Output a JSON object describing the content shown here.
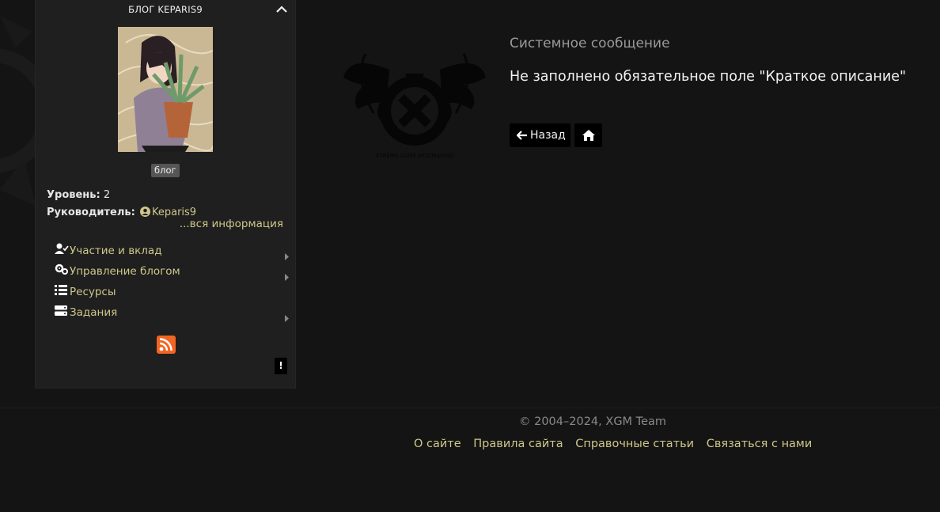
{
  "sidebar": {
    "title": "БЛОГ KEPARIS9",
    "badge": "блог",
    "level_label": "Уровень:",
    "level_value": "2",
    "leader_label": "Руководитель:",
    "leader_name": "Keparis9",
    "more_info": "...вся информация",
    "menu": [
      {
        "label": "Участие и вклад",
        "icon": "user-check-icon",
        "has_submenu": true
      },
      {
        "label": "Управление блогом",
        "icon": "gears-icon",
        "has_submenu": true
      },
      {
        "label": "Ресурсы",
        "icon": "list-icon",
        "has_submenu": false
      },
      {
        "label": "Задания",
        "icon": "server-icon",
        "has_submenu": true
      }
    ],
    "report_label": "!"
  },
  "message": {
    "title": "Системное сообщение",
    "text": "Не заполнено обязательное поле \"Краткое описание\"",
    "back_label": "Назад"
  },
  "footer": {
    "copyright": "© 2004–2024, XGM Team",
    "links": [
      "О сайте",
      "Правила сайта",
      "Справочные статьи",
      "Связаться с нами"
    ]
  },
  "colors": {
    "background": "#141414",
    "sidebar": "#1f1f1f",
    "link": "#cfc78a",
    "rss": "#f26522"
  }
}
